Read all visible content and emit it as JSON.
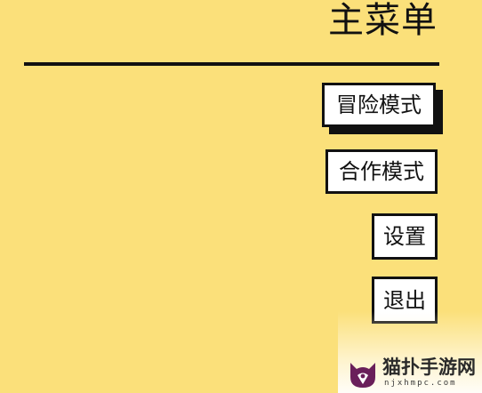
{
  "header": {
    "title": "主菜单"
  },
  "menu": {
    "items": [
      {
        "label": "冒险模式",
        "selected": true
      },
      {
        "label": "合作模式",
        "selected": false
      },
      {
        "label": "设置",
        "selected": false
      },
      {
        "label": "退出",
        "selected": false
      }
    ]
  },
  "watermark": {
    "name": "猫扑手游网",
    "domain": "njxhmpc.com"
  },
  "colors": {
    "background": "#fbe07a",
    "ink": "#111111",
    "button_fill": "#ffffff",
    "watermark_logo": "#6a1f5a"
  },
  "icons": {
    "watermark_logo": "cat-head-logo-icon"
  }
}
